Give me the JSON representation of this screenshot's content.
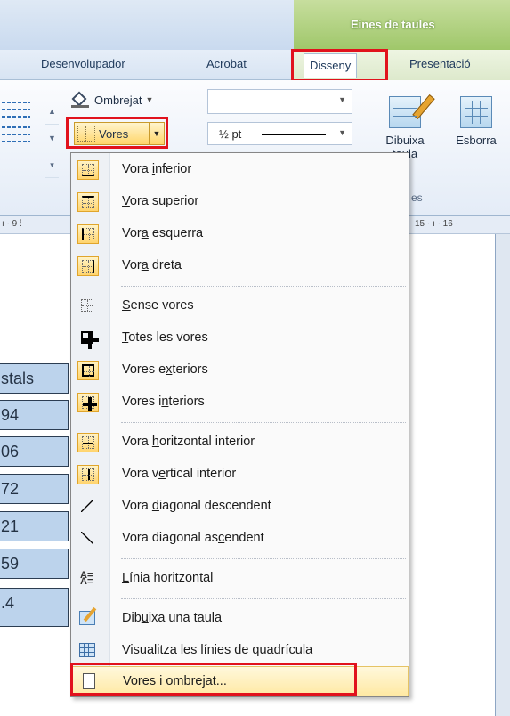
{
  "ribbon": {
    "context_title": "Eines de taules",
    "tabs": [
      {
        "label": "Desenvolupador"
      },
      {
        "label": "Acrobat"
      },
      {
        "label": "Disseny"
      },
      {
        "label": "Presentació"
      }
    ],
    "shading_label": "Ombrejat",
    "borders_label": "Vores",
    "pen_weight": "½ pt",
    "draw_table": [
      "Dibuixa",
      "taula"
    ],
    "eraser": "Esborra",
    "group_fragment": "es"
  },
  "ruler": {
    "left_ticks": "ı · 9 ⁞",
    "right_ticks": "15 · ı · 16 ·"
  },
  "table_cells": [
    "stals",
    "94",
    "06",
    "72",
    "21",
    "59",
    ".4"
  ],
  "menu": {
    "items": [
      {
        "pre": "Vora ",
        "u": "i",
        "post": "nferior",
        "icon": "border-bottom-icon"
      },
      {
        "pre": "",
        "u": "V",
        "post": "ora superior",
        "icon": "border-top-icon"
      },
      {
        "pre": "Vor",
        "u": "a",
        "post": " esquerra",
        "icon": "border-left-icon"
      },
      {
        "pre": "Vor",
        "u": "a",
        "post": " dreta",
        "icon": "border-right-icon"
      },
      {
        "pre": "",
        "u": "S",
        "post": "ense vores",
        "icon": "no-border-icon"
      },
      {
        "pre": "",
        "u": "T",
        "post": "otes les vores",
        "icon": "all-borders-icon"
      },
      {
        "pre": "Vores e",
        "u": "x",
        "post": "teriors",
        "icon": "outside-borders-icon"
      },
      {
        "pre": "Vores i",
        "u": "n",
        "post": "teriors",
        "icon": "inside-borders-icon"
      },
      {
        "pre": "Vora ",
        "u": "h",
        "post": "oritzontal interior",
        "icon": "inside-horizontal-border-icon"
      },
      {
        "pre": "Vora v",
        "u": "e",
        "post": "rtical interior",
        "icon": "inside-vertical-border-icon"
      },
      {
        "pre": "Vora ",
        "u": "d",
        "post": "iagonal descendent",
        "icon": "diagonal-down-border-icon"
      },
      {
        "pre": "Vora diagonal as",
        "u": "c",
        "post": "endent",
        "icon": "diagonal-up-border-icon"
      },
      {
        "pre": "",
        "u": "L",
        "post": "ínia horitzontal",
        "icon": "horizontal-line-icon"
      },
      {
        "pre": "Dib",
        "u": "u",
        "post": "ixa una taula",
        "icon": "draw-table-icon"
      },
      {
        "pre": "Visualit",
        "u": "z",
        "post": "a les línies de quadrícula",
        "icon": "view-gridlines-icon"
      },
      {
        "pre": "Vores i ombrejat...",
        "u": "",
        "post": "",
        "icon": "borders-and-shading-icon"
      }
    ]
  },
  "colors": {
    "highlight_red": "#e1121d",
    "context_green": "#9fc76a",
    "table_fill": "#bcd3ec",
    "hover_yellow": "#ffd66b"
  }
}
